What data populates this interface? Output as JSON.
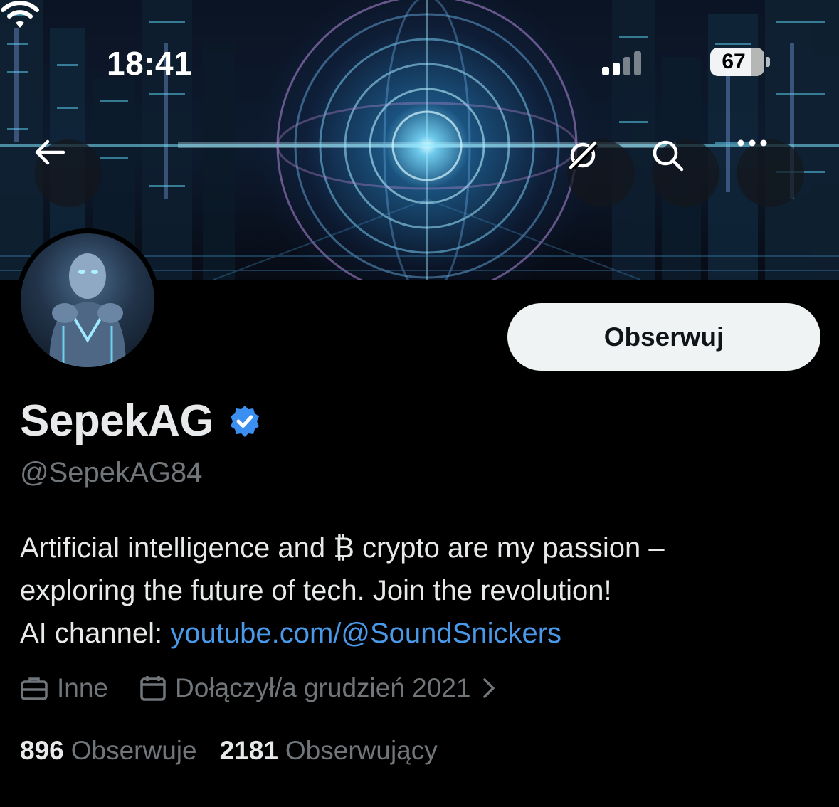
{
  "status_bar": {
    "time": "18:41",
    "battery": "67"
  },
  "nav": {
    "back_icon": "arrow-left-icon",
    "grok_icon": "grok-icon",
    "search_icon": "search-icon",
    "more_icon": "more-horizontal-icon"
  },
  "profile": {
    "display_name": "SepekAG",
    "handle": "@SepekAG84",
    "verified": true,
    "follow_label": "Obserwuj",
    "bio_line1": "Artificial intelligence and ₿ crypto are my passion –",
    "bio_line2": "exploring the future of tech. Join the revolution!",
    "bio_line3_prefix": "AI channel: ",
    "bio_link": "youtube.com/@SoundSnickers",
    "category": "Inne",
    "joined": "Dołączył/a grudzień 2021",
    "following_count": "896",
    "following_label": "Obserwuje",
    "followers_count": "2181",
    "followers_label": "Obserwujący"
  },
  "colors": {
    "background": "#000000",
    "link": "#4a99e9",
    "verified_badge": "#3b8ff0",
    "muted_text": "#71767b",
    "follow_button_bg": "#eff3f4"
  }
}
